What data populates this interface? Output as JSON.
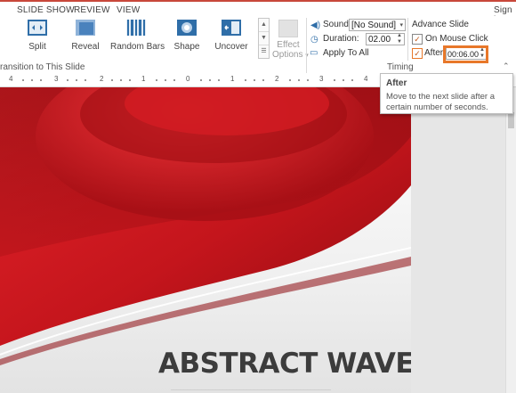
{
  "tabs": [
    {
      "label": "SLIDE SHOW"
    },
    {
      "label": "REVIEW"
    },
    {
      "label": "VIEW"
    }
  ],
  "sign_in": "Sign in",
  "transitions": [
    {
      "label": "Split",
      "icon": "split-icon"
    },
    {
      "label": "Reveal",
      "icon": "reveal-icon"
    },
    {
      "label": "Random Bars",
      "icon": "random-bars-icon"
    },
    {
      "label": "Shape",
      "icon": "shape-icon"
    },
    {
      "label": "Uncover",
      "icon": "uncover-icon"
    }
  ],
  "effect_options": {
    "line1": "Effect",
    "line2": "Options",
    "caret": "▾"
  },
  "group_transition_label": "ransition to This Slide",
  "timing": {
    "sound_label": "Sound:",
    "sound_value": "[No Sound]",
    "duration_label": "Duration:",
    "duration_value": "02.00",
    "apply_all_label": "Apply To All",
    "advance_header": "Advance Slide",
    "on_mouse_click_label": "On Mouse Click",
    "on_mouse_click_checked": "✓",
    "after_label": "After:",
    "after_checked": "✓",
    "after_value": "00:06.00",
    "group_label": "Timing"
  },
  "ruler": [
    "4",
    "3",
    "2",
    "1",
    "0",
    "1",
    "2",
    "3",
    "4"
  ],
  "tooltip": {
    "title": "After",
    "body": "Move to the next slide after a certain number of seconds."
  },
  "slide": {
    "title": "ABSTRACT WAVE"
  },
  "colors": {
    "accent": "#c8483b",
    "highlight": "#e8782a",
    "slide_red": "#c4151c"
  }
}
